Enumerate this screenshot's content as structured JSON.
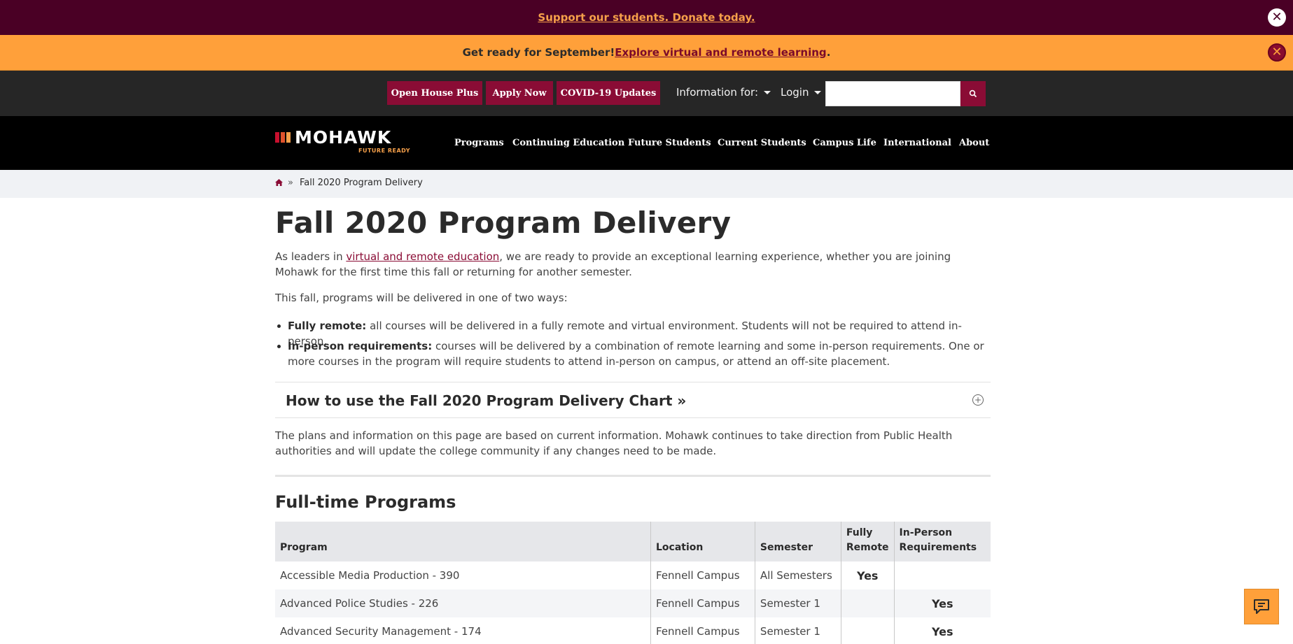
{
  "alerts": {
    "donate_link": "Support our students. Donate today.",
    "ready_text": "Get ready for September! ",
    "ready_link": "Explore virtual and remote learning",
    "ready_end": ".",
    "close_glyph": "✕"
  },
  "utility_nav": {
    "buttons": [
      "Open House Plus",
      "Apply Now",
      "COVID-19 Updates"
    ],
    "info_for": "Information for:",
    "login": "Login",
    "search_placeholder": ""
  },
  "logo": {
    "wordmark": "MOHAWK",
    "tagline": "FUTURE READY",
    "bar_colors": [
      "#c8102e",
      "#e0522b",
      "#f6a04a"
    ]
  },
  "main_nav": {
    "items": [
      "Programs",
      "Continuing Education",
      "Future Students",
      "Current Students",
      "Campus Life",
      "International",
      "About"
    ]
  },
  "breadcrumb": {
    "separator": "»",
    "current": "Fall 2020 Program Delivery"
  },
  "page": {
    "title": "Fall 2020 Program Delivery",
    "intro_before": "As leaders in ",
    "intro_link": "virtual and remote education",
    "intro_after": ", we are ready to provide an exceptional learning experience, whether you are joining Mohawk for the first time this fall or returning for another semester.",
    "ways_intro": "This fall, programs will be delivered in one of two ways:",
    "bullets": [
      {
        "term": "Fully remote:",
        "text": " all courses will be delivered in a fully remote and virtual environment. Students will not be required to attend in-person."
      },
      {
        "term": "In-person requirements:",
        "text": " courses will be delivered by a combination of remote learning and some in-person requirements. One or more courses in the program will require students to attend in-person on campus, or attend an off-site placement."
      }
    ],
    "accordion_title": "How to use the Fall 2020 Program Delivery Chart »",
    "accordion_glyph": "+",
    "disclaimer": "The plans and information on this page are based on current information. Mohawk continues to take direction from Public Health authorities and will update the college community if any changes need to be made.",
    "section_title": "Full-time Programs"
  },
  "table": {
    "headers": [
      "Program",
      "Location",
      "Semester",
      "Fully Remote",
      "In-Person Requirements"
    ],
    "rows": [
      [
        "Accessible Media Production - 390",
        "Fennell Campus",
        "All Semesters",
        "Yes",
        ""
      ],
      [
        "Advanced Police Studies - 226",
        "Fennell Campus",
        "Semester 1",
        "",
        "Yes"
      ],
      [
        "Advanced Security Management - 174",
        "Fennell Campus",
        "Semester 1",
        "",
        "Yes"
      ]
    ]
  },
  "colors": {
    "maroon": "#4a0025",
    "orange": "#ffa03a",
    "brand_red": "#8a0c35"
  }
}
